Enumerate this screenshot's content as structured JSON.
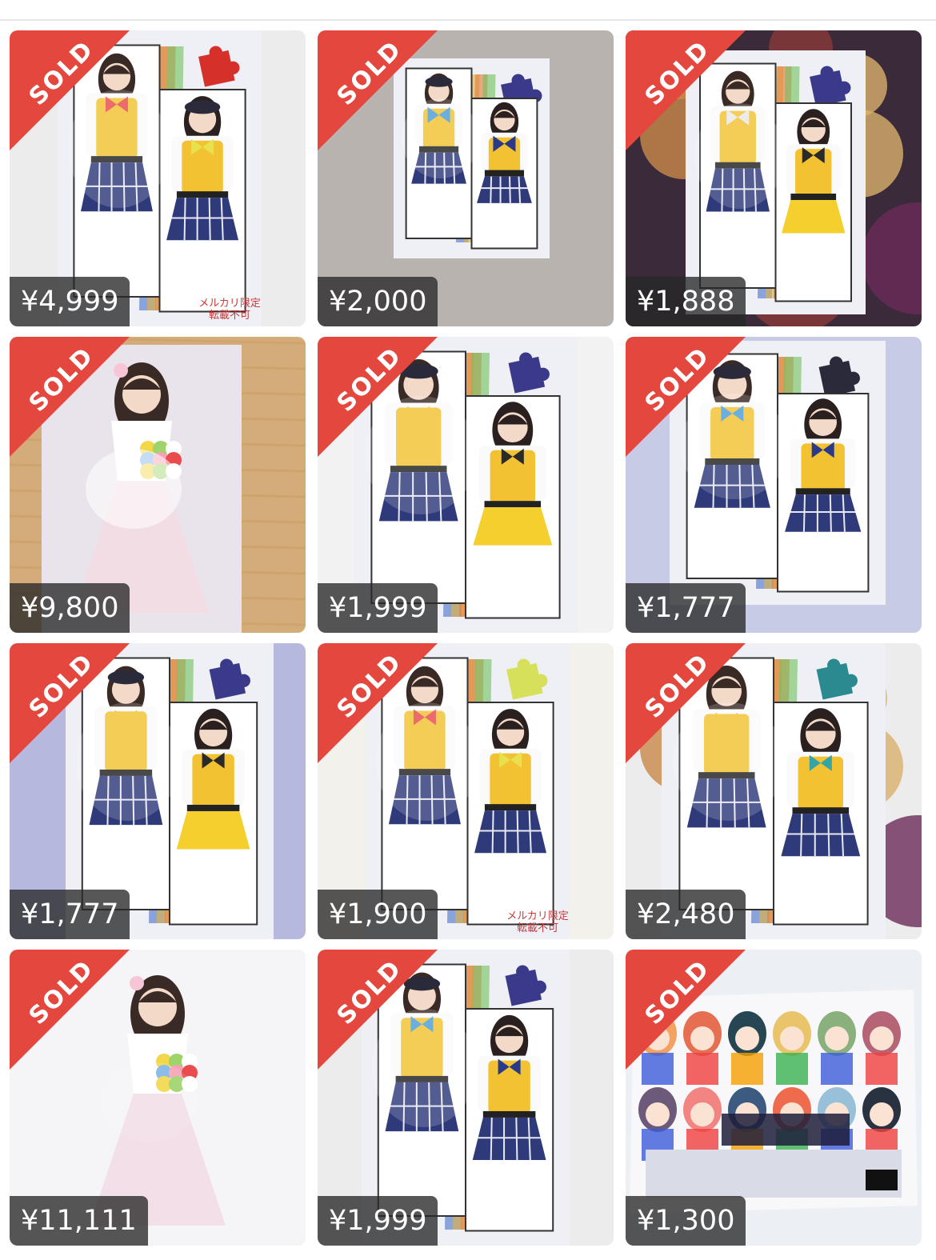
{
  "sold_label": "SOLD",
  "colors": {
    "sold_ribbon": "#e4473d",
    "price_overlay": "#2b2b2b",
    "divider": "#e6e6e6"
  },
  "items": [
    {
      "price": "¥4,999",
      "sold": true,
      "photo": "two-member-clear-file-yellow-outfits",
      "photo_text": "メルカリ限定\n転載不可"
    },
    {
      "price": "¥2,000",
      "sold": true,
      "photo": "two-member-clear-file-on-plastic-bag",
      "photo_text": ""
    },
    {
      "price": "¥1,888",
      "sold": true,
      "photo": "two-member-clear-file-anime-background",
      "photo_text": ""
    },
    {
      "price": "¥9,800",
      "sold": true,
      "photo": "single-member-bouquet-photo-on-wood",
      "photo_text": ""
    },
    {
      "price": "¥1,999",
      "sold": true,
      "photo": "two-member-clear-file-dark-background",
      "photo_text": ""
    },
    {
      "price": "¥1,777",
      "sold": true,
      "photo": "two-member-clear-file-blue-background",
      "photo_text": ""
    },
    {
      "price": "¥1,777",
      "sold": true,
      "photo": "two-member-clear-file-purple-background",
      "photo_text": ""
    },
    {
      "price": "¥1,900",
      "sold": true,
      "photo": "two-member-clear-file-pastel",
      "photo_text": "メルカリ限定\n転載不可"
    },
    {
      "price": "¥2,480",
      "sold": true,
      "photo": "two-member-clear-file-teal-puzzle",
      "photo_text": ""
    },
    {
      "price": "¥11,111",
      "sold": true,
      "photo": "single-member-bouquet-white-dress",
      "photo_text": ""
    },
    {
      "price": "¥1,999",
      "sold": true,
      "photo": "two-member-clear-file-star",
      "photo_text": ""
    },
    {
      "price": "¥1,300",
      "sold": true,
      "photo": "group-anime-poster",
      "photo_text": ""
    }
  ]
}
